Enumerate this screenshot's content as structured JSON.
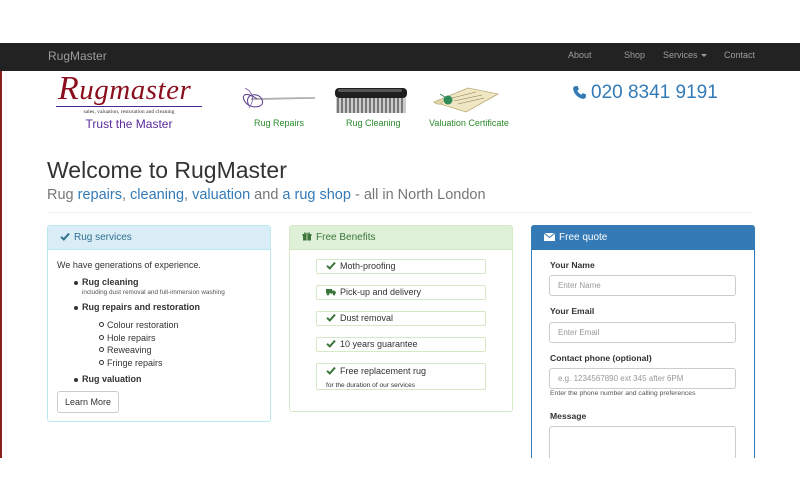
{
  "navbar": {
    "brand": "RugMaster",
    "links": [
      "About",
      "Shop",
      "Services",
      "Contact"
    ]
  },
  "logo": {
    "name_cap": "R",
    "name_rest": "ugmaster",
    "tagline": "sales, valuation, restoration and cleaning",
    "slogan": "Trust the Master"
  },
  "services": [
    {
      "label": "Rug Repairs",
      "icon": "needle-thread-icon"
    },
    {
      "label": "Rug Cleaning",
      "icon": "brush-icon"
    },
    {
      "label": "Valuation Certificate",
      "icon": "certificate-scroll-icon"
    }
  ],
  "phone": {
    "number": "020 8341 9191",
    "icon": "phone-icon"
  },
  "hero": {
    "title": "Welcome to RugMaster",
    "sub": {
      "t1": "Rug ",
      "l1": "repairs",
      "t2": ", ",
      "l2": "cleaning",
      "t3": ", ",
      "l3": "valuation",
      "t4": " and ",
      "l4": "a rug shop",
      "t5": " - all in North London"
    }
  },
  "rug_services": {
    "heading": "Rug services",
    "intro": "We have generations of experience.",
    "cleaning": "Rug cleaning",
    "cleaning_note": "including dust removal and full-immersion washing",
    "repairs": "Rug repairs and restoration",
    "repair_items": [
      "Colour restoration",
      "Hole repairs",
      "Reweaving",
      "Fringe repairs"
    ],
    "valuation": "Rug valuation",
    "button": "Learn More"
  },
  "benefits": {
    "heading": "Free Benefits",
    "items": [
      {
        "label": "Moth-proofing",
        "icon": "check-icon"
      },
      {
        "label": "Pick-up and delivery",
        "icon": "truck-icon"
      },
      {
        "label": "Dust removal",
        "icon": "check-icon"
      },
      {
        "label": "10 years guarantee",
        "icon": "check-icon"
      },
      {
        "label": "Free replacement rug",
        "icon": "check-icon",
        "note": "for the duration of our services"
      }
    ]
  },
  "quote": {
    "heading": "Free quote",
    "name_label": "Your Name",
    "name_placeholder": "Enter Name",
    "email_label": "Your Email",
    "email_placeholder": "Enter Email",
    "phone_label": "Contact phone (optional)",
    "phone_placeholder": "e.g. 1234567890 ext 345 after 6PM",
    "phone_help": "Enter the phone number and calling preferences",
    "message_label": "Message"
  },
  "colors": {
    "navbar": "#222222",
    "link": "#337ab7",
    "logo_red": "#8b0e1e",
    "service_green": "#2a8a2a",
    "info_bg": "#d9edf7",
    "success_bg": "#dff0d8",
    "primary": "#337ab7"
  }
}
